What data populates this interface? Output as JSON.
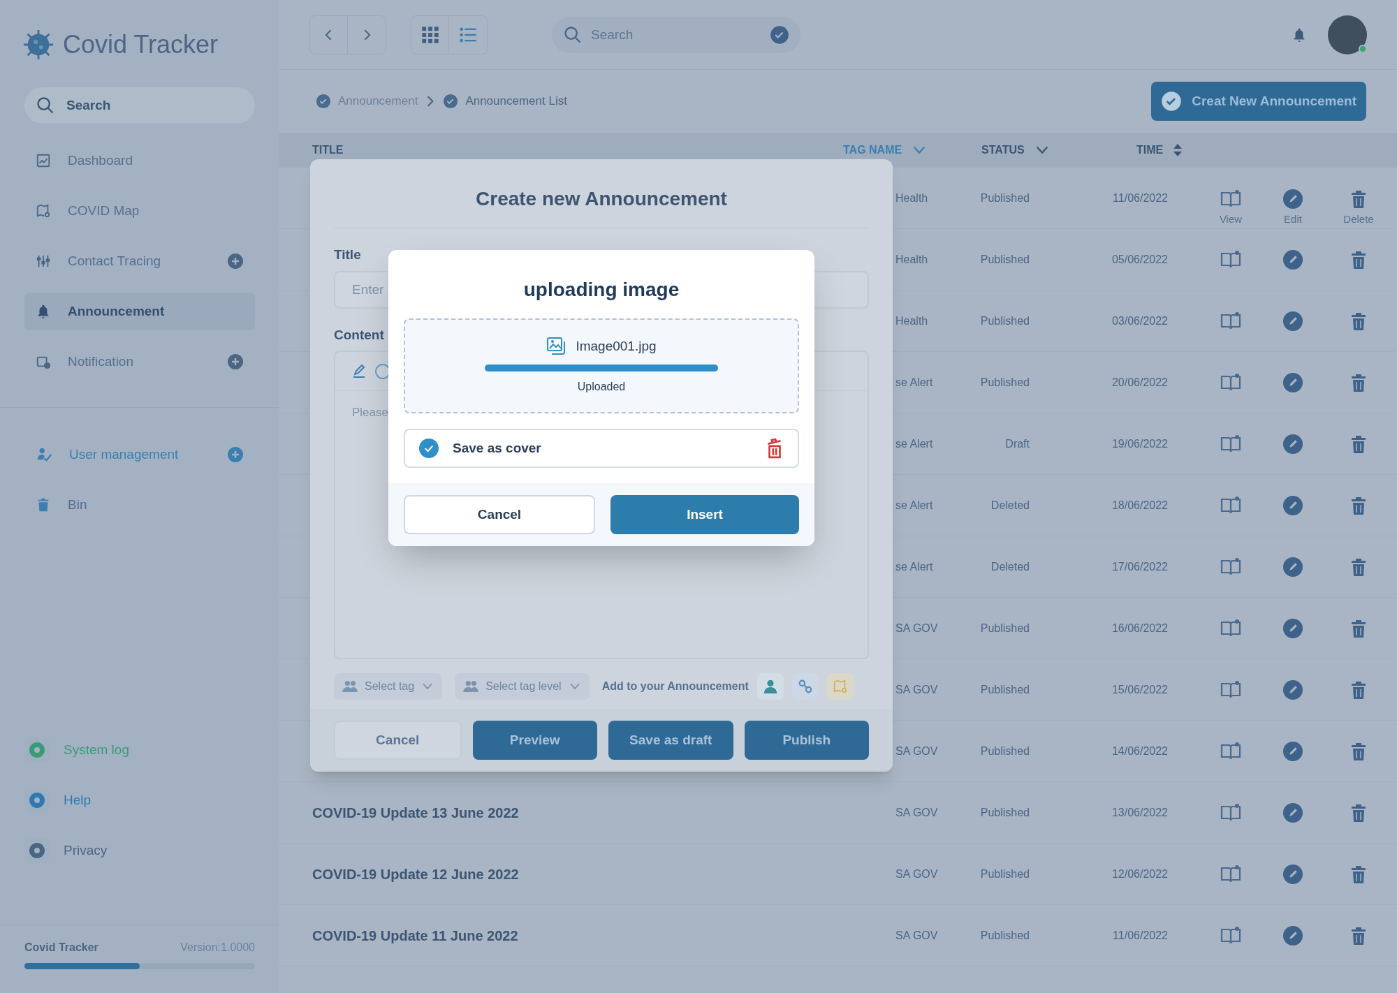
{
  "sidebar": {
    "brand": "Covid Tracker",
    "search": {
      "placeholder": "Search"
    },
    "nav": [
      {
        "label": "Dashboard",
        "selected": false,
        "highlighted": false,
        "expandable": false
      },
      {
        "label": "COVID Map",
        "selected": false,
        "highlighted": false,
        "expandable": false
      },
      {
        "label": "Contact Tracing",
        "selected": false,
        "highlighted": false,
        "expandable": true
      },
      {
        "label": "Announcement",
        "selected": true,
        "highlighted": false,
        "expandable": false
      },
      {
        "label": "Notification",
        "selected": false,
        "highlighted": false,
        "expandable": true
      }
    ],
    "nav_secondary": [
      {
        "label": "User management",
        "selected": false,
        "highlighted": true,
        "expandable": true
      },
      {
        "label": "Bin",
        "selected": false,
        "highlighted": false,
        "expandable": false
      }
    ],
    "bottom": [
      {
        "label": "System log",
        "color": "#3a9a78"
      },
      {
        "label": "Help",
        "color": "#2f78b0"
      },
      {
        "label": "Privacy",
        "color": "#4b6584"
      }
    ],
    "footer": {
      "name": "Covid Tracker",
      "version": "Version:1.0000",
      "level": 0.5
    }
  },
  "topbar": {
    "search": {
      "placeholder": "Search"
    },
    "user": {
      "online": true
    }
  },
  "breadcrumb": [
    "Announcement",
    "Announcement List"
  ],
  "create_button": "Creat New Announcement",
  "table": {
    "columns": [
      {
        "label": "TITLE",
        "kind": "plain",
        "active": false
      },
      {
        "label": "TAG NAME",
        "kind": "dropdown",
        "active": true
      },
      {
        "label": "STATUS",
        "kind": "dropdown",
        "active": false
      },
      {
        "label": "TIME",
        "kind": "sort",
        "active": false
      }
    ],
    "rows": [
      {
        "tag": "Health",
        "status": "Published",
        "time": "11/06/2022",
        "action_labels": [
          "View",
          "Edit",
          "Delete"
        ]
      },
      {
        "tag": "Health",
        "status": "Published",
        "time": "05/06/2022"
      },
      {
        "tag": "Health",
        "status": "Published",
        "time": "03/06/2022"
      },
      {
        "tag": "se Alert",
        "status": "Published",
        "time": "20/06/2022"
      },
      {
        "tag": "se Alert",
        "status": "Draft",
        "time": "19/06/2022"
      },
      {
        "tag": "se Alert",
        "status": "Deleted",
        "time": "18/06/2022"
      },
      {
        "tag": "se Alert",
        "status": "Deleted",
        "time": "17/06/2022"
      },
      {
        "tag": "SA GOV",
        "status": "Published",
        "time": "16/06/2022"
      },
      {
        "tag": "SA GOV",
        "status": "Published",
        "time": "15/06/2022"
      },
      {
        "tag": "SA GOV",
        "status": "Published",
        "time": "14/06/2022"
      },
      {
        "title": "COVID-19 Update 13 June 2022",
        "tag": "SA GOV",
        "status": "Published",
        "time": "13/06/2022"
      },
      {
        "title": "COVID-19 Update 12 June 2022",
        "tag": "SA GOV",
        "status": "Published",
        "time": "12/06/2022"
      },
      {
        "title": "COVID-19 Update 11 June 2022",
        "tag": "SA GOV",
        "status": "Published",
        "time": "11/06/2022"
      }
    ]
  },
  "create_dialog": {
    "title": "Create new Announcement",
    "title_label": "Title",
    "title_placeholder": "Enter",
    "content_label": "Content",
    "content_placeholder": "Please",
    "selects": [
      "Select tag",
      "Select tag level"
    ],
    "add_label": "Add to your Announcement",
    "buttons": [
      {
        "label": "Cancel",
        "kind": "secondary"
      },
      {
        "label": "Preview",
        "kind": "primary"
      },
      {
        "label": "Save as draft",
        "kind": "primary"
      },
      {
        "label": "Publish",
        "kind": "primary"
      }
    ]
  },
  "upload_dialog": {
    "title": "uploading image",
    "file": "Image001.jpg",
    "level": 1,
    "status": "Uploaded",
    "cover": {
      "label": "Save as cover",
      "checked": true
    },
    "buttons": [
      {
        "label": "Cancel",
        "kind": "secondary"
      },
      {
        "label": "Insert",
        "kind": "primary"
      }
    ]
  }
}
